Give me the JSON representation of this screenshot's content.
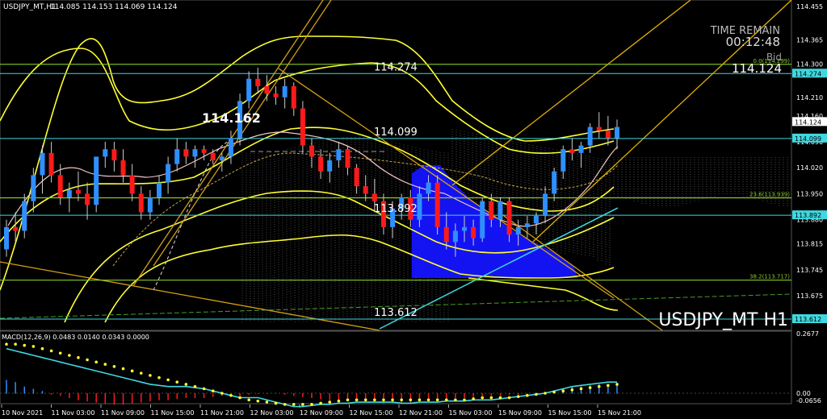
{
  "header": {
    "symbol_tf": "USDJPY_MT,H1",
    "ohlc": "114.085 114.153 114.069 114.124"
  },
  "overlay": {
    "time_remain_label": "TIME REMAIN",
    "time_remain_value": "00:12:48",
    "bid_label": "Bid",
    "bid_value": "114.124",
    "watermark": "USDJPY_MT H1",
    "peak_label": "114.162"
  },
  "levels": [
    {
      "label": "114.274",
      "price": 114.274,
      "color": "#3fd8e0"
    },
    {
      "label": "114.099",
      "price": 114.099,
      "color": "#3fd8e0"
    },
    {
      "label": "113.892",
      "price": 113.892,
      "color": "#3fd8e0"
    },
    {
      "label": "113.612",
      "price": 113.612,
      "color": "#3fd8e0"
    }
  ],
  "fib_levels": [
    {
      "label": "0.0(114.299)",
      "price": 114.299
    },
    {
      "label": "23.6(113.939)",
      "price": 113.939
    },
    {
      "label": "38.2(113.717)",
      "price": 113.717
    }
  ],
  "price_axis": {
    "ticks": [
      "114.455",
      "114.365",
      "114.300",
      "114.210",
      "114.160",
      "114.090",
      "114.020",
      "113.950",
      "113.880",
      "113.815",
      "113.745",
      "113.675",
      "113.612"
    ],
    "ticks_shown": [
      "114.455",
      "114.365",
      "114.300",
      "114.210",
      "114.160",
      "114.090",
      "114.020",
      "113.950",
      "113.880",
      "113.815",
      "113.745",
      "113.675"
    ],
    "tag_bid": "114.124",
    "tag_274": "114.274",
    "tag_099": "114.099",
    "tag_892": "113.892",
    "tag_612": "113.612"
  },
  "macd": {
    "label": "MACD(12,26,9) 0.0483 0.0140 0.0343 0.0000",
    "ticks": [
      "0.2677",
      "0.00",
      "-0.0656"
    ]
  },
  "time_axis": [
    "10 Nov 2021",
    "11 Nov 03:00",
    "11 Nov 09:00",
    "11 Nov 15:00",
    "11 Nov 21:00",
    "12 Nov 03:00",
    "12 Nov 09:00",
    "12 Nov 15:00",
    "12 Nov 21:00",
    "15 Nov 03:00",
    "15 Nov 09:00",
    "15 Nov 15:00",
    "15 Nov 21:00"
  ],
  "colors": {
    "bull": "#2f8fff",
    "bear": "#ff1a1a",
    "band": "#ffff33",
    "level": "#3fd8e0",
    "fib": "#8acb2a",
    "cloud": "#1414ff"
  },
  "candles": [
    [
      113.8,
      113.88,
      113.78,
      113.86
    ],
    [
      113.86,
      113.9,
      113.82,
      113.85
    ],
    [
      113.85,
      113.95,
      113.83,
      113.93
    ],
    [
      113.93,
      114.02,
      113.9,
      114.0
    ],
    [
      114.0,
      114.08,
      113.95,
      114.06
    ],
    [
      114.06,
      114.09,
      113.98,
      114.0
    ],
    [
      114.0,
      114.03,
      113.92,
      113.94
    ],
    [
      113.94,
      113.98,
      113.9,
      113.96
    ],
    [
      113.96,
      114.01,
      113.93,
      113.95
    ],
    [
      113.95,
      113.98,
      113.88,
      113.92
    ],
    [
      113.92,
      114.02,
      113.9,
      114.05
    ],
    [
      114.05,
      114.09,
      114.02,
      114.07
    ],
    [
      114.07,
      114.09,
      114.01,
      114.04
    ],
    [
      114.04,
      114.07,
      113.98,
      114.0
    ],
    [
      114.0,
      114.03,
      113.93,
      113.95
    ],
    [
      113.95,
      113.97,
      113.88,
      113.9
    ],
    [
      113.9,
      113.96,
      113.88,
      113.94
    ],
    [
      113.94,
      114.0,
      113.92,
      113.98
    ],
    [
      113.98,
      114.05,
      113.95,
      114.03
    ],
    [
      114.03,
      114.1,
      114.01,
      114.07
    ],
    [
      114.07,
      114.09,
      114.03,
      114.05
    ],
    [
      114.05,
      114.08,
      114.02,
      114.07
    ],
    [
      114.07,
      114.08,
      114.04,
      114.06
    ],
    [
      114.06,
      114.07,
      114.03,
      114.04
    ],
    [
      114.04,
      114.06,
      114.01,
      114.05
    ],
    [
      114.05,
      114.12,
      114.03,
      114.1
    ],
    [
      114.1,
      114.22,
      114.08,
      114.2
    ],
    [
      114.2,
      114.28,
      114.18,
      114.26
    ],
    [
      114.26,
      114.29,
      114.22,
      114.24
    ],
    [
      114.24,
      114.27,
      114.2,
      114.22
    ],
    [
      114.22,
      114.24,
      114.19,
      114.21
    ],
    [
      114.21,
      114.26,
      114.18,
      114.24
    ],
    [
      114.24,
      114.25,
      114.16,
      114.18
    ],
    [
      114.18,
      114.2,
      114.06,
      114.08
    ],
    [
      114.08,
      114.1,
      114.02,
      114.05
    ],
    [
      114.05,
      114.07,
      113.99,
      114.01
    ],
    [
      114.01,
      114.06,
      113.98,
      114.04
    ],
    [
      114.04,
      114.09,
      114.02,
      114.07
    ],
    [
      114.07,
      114.08,
      114.0,
      114.02
    ],
    [
      114.02,
      114.03,
      113.95,
      113.97
    ],
    [
      113.97,
      114.0,
      113.93,
      113.95
    ],
    [
      113.95,
      113.99,
      113.9,
      113.93
    ],
    [
      113.93,
      113.95,
      113.84,
      113.86
    ],
    [
      113.86,
      113.93,
      113.83,
      113.91
    ],
    [
      113.91,
      113.95,
      113.88,
      113.94
    ],
    [
      113.94,
      113.96,
      113.86,
      113.88
    ],
    [
      113.88,
      113.97,
      113.86,
      113.95
    ],
    [
      113.95,
      114.0,
      113.93,
      113.98
    ],
    [
      113.98,
      114.0,
      113.84,
      113.86
    ],
    [
      113.86,
      113.9,
      113.8,
      113.82
    ],
    [
      113.82,
      113.87,
      113.78,
      113.85
    ],
    [
      113.85,
      113.89,
      113.82,
      113.86
    ],
    [
      113.86,
      113.88,
      113.81,
      113.83
    ],
    [
      113.83,
      113.94,
      113.82,
      113.93
    ],
    [
      113.93,
      113.95,
      113.86,
      113.88
    ],
    [
      113.88,
      113.94,
      113.86,
      113.93
    ],
    [
      113.93,
      113.94,
      113.82,
      113.84
    ],
    [
      113.84,
      113.88,
      113.81,
      113.86
    ],
    [
      113.86,
      113.89,
      113.83,
      113.87
    ],
    [
      113.87,
      113.9,
      113.84,
      113.89
    ],
    [
      113.89,
      113.97,
      113.87,
      113.95
    ],
    [
      113.95,
      114.02,
      113.93,
      114.01
    ],
    [
      114.01,
      114.08,
      113.99,
      114.07
    ],
    [
      114.07,
      114.1,
      114.04,
      114.06
    ],
    [
      114.06,
      114.09,
      114.02,
      114.08
    ],
    [
      114.08,
      114.14,
      114.06,
      114.13
    ],
    [
      114.13,
      114.17,
      114.1,
      114.12
    ],
    [
      114.12,
      114.16,
      114.08,
      114.1
    ],
    [
      114.1,
      114.15,
      114.07,
      114.13
    ]
  ],
  "macd_hist": [
    0.06,
    0.05,
    0.03,
    0.02,
    0.01,
    -0.005,
    -0.01,
    -0.02,
    -0.03,
    -0.035,
    -0.04,
    -0.045,
    -0.05,
    -0.05,
    -0.045,
    -0.04,
    -0.035,
    -0.03,
    -0.03,
    -0.025,
    -0.02,
    -0.02,
    -0.02,
    -0.015,
    -0.01,
    -0.01,
    -0.01,
    -0.005,
    0.0,
    0.0,
    0.0,
    -0.005,
    -0.01,
    -0.015,
    -0.02,
    -0.025,
    -0.03,
    -0.03,
    -0.035,
    -0.035,
    -0.04,
    -0.04,
    -0.045,
    -0.045,
    -0.04,
    -0.04,
    -0.035,
    -0.03,
    -0.03,
    -0.025,
    -0.02,
    -0.02,
    -0.015,
    -0.01,
    -0.01,
    -0.01,
    -0.005,
    -0.005,
    0.0,
    0.0,
    0.005,
    0.01,
    0.02,
    0.03,
    0.03,
    0.035,
    0.04,
    0.04,
    0.045
  ],
  "macd_signal": [
    0.22,
    0.22,
    0.215,
    0.21,
    0.2,
    0.19,
    0.18,
    0.17,
    0.16,
    0.15,
    0.14,
    0.13,
    0.12,
    0.11,
    0.1,
    0.09,
    0.08,
    0.07,
    0.06,
    0.05,
    0.04,
    0.03,
    0.02,
    0.01,
    0.0,
    -0.01,
    -0.02,
    -0.03,
    -0.035,
    -0.04,
    -0.045,
    -0.05,
    -0.05,
    -0.05,
    -0.05,
    -0.045,
    -0.04,
    -0.035,
    -0.03,
    -0.03,
    -0.03,
    -0.03,
    -0.03,
    -0.03,
    -0.03,
    -0.03,
    -0.03,
    -0.03,
    -0.03,
    -0.03,
    -0.03,
    -0.03,
    -0.025,
    -0.02,
    -0.02,
    -0.02,
    -0.02,
    -0.015,
    -0.01,
    -0.005,
    0.0,
    0.005,
    0.01,
    0.015,
    0.02,
    0.025,
    0.03,
    0.035,
    0.04
  ],
  "macd_line": [
    0.2,
    0.19,
    0.18,
    0.17,
    0.16,
    0.15,
    0.14,
    0.13,
    0.12,
    0.11,
    0.1,
    0.09,
    0.08,
    0.07,
    0.06,
    0.05,
    0.04,
    0.035,
    0.03,
    0.03,
    0.03,
    0.025,
    0.02,
    0.01,
    0.0,
    -0.01,
    -0.02,
    -0.02,
    -0.02,
    -0.03,
    -0.04,
    -0.05,
    -0.06,
    -0.06,
    -0.055,
    -0.05,
    -0.05,
    -0.045,
    -0.045,
    -0.04,
    -0.04,
    -0.04,
    -0.04,
    -0.04,
    -0.045,
    -0.045,
    -0.04,
    -0.04,
    -0.04,
    -0.035,
    -0.035,
    -0.035,
    -0.03,
    -0.03,
    -0.03,
    -0.025,
    -0.02,
    -0.015,
    -0.01,
    -0.005,
    0.0,
    0.01,
    0.02,
    0.03,
    0.035,
    0.04,
    0.045,
    0.05,
    0.05
  ]
}
